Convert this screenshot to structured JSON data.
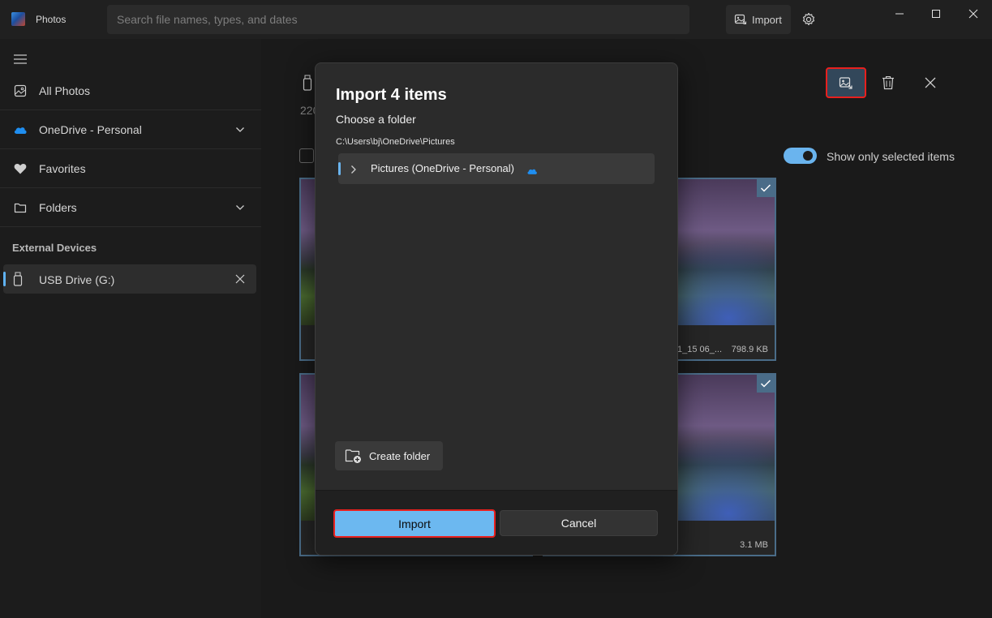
{
  "app": {
    "title": "Photos",
    "search_placeholder": "Search file names, types, and dates",
    "import_label": "Import",
    "icons": {
      "logo": "photos-logo-icon",
      "import": "image-import-icon",
      "settings": "gear-icon"
    }
  },
  "window_controls": {
    "minimize": "minimize-icon",
    "maximize": "maximize-icon",
    "close": "close-icon"
  },
  "sidebar": {
    "items": [
      {
        "label": "All Photos",
        "icon": "image-icon"
      },
      {
        "label": "OneDrive - Personal",
        "icon": "cloud-icon",
        "expandable": true
      },
      {
        "label": "Favorites",
        "icon": "heart-icon"
      },
      {
        "label": "Folders",
        "icon": "folder-icon",
        "expandable": true
      }
    ],
    "section_header": "External Devices",
    "device": {
      "label": "USB Drive (G:)",
      "icon": "usb-drive-icon"
    }
  },
  "main": {
    "subtitle": "220",
    "toggle_label": "Show only selected items",
    "toggle_on": true,
    "photos": [
      {
        "meta_name": "1_15 06_...",
        "meta_size": "798.9 KB"
      },
      {
        "meta_name": "",
        "meta_size": "3.1 MB"
      }
    ]
  },
  "dialog": {
    "title": "Import 4 items",
    "subtitle": "Choose a folder",
    "path": "C:\\Users\\bj\\OneDrive\\Pictures",
    "folder_label": "Pictures (OneDrive - Personal)",
    "create_folder_label": "Create folder",
    "import_label": "Import",
    "cancel_label": "Cancel"
  },
  "colors": {
    "accent": "#6cb8f0",
    "highlight_border": "#e8201e",
    "background": "#1c1c1c"
  }
}
